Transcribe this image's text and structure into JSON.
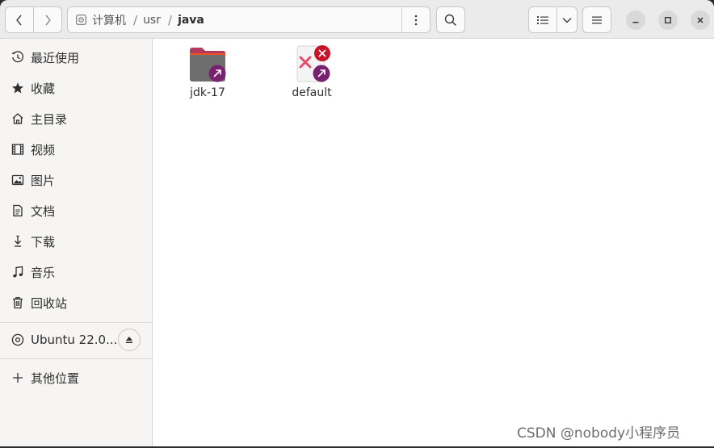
{
  "header": {
    "path": [
      "计算机",
      "usr",
      "java"
    ],
    "separator": "/"
  },
  "sidebar": {
    "items": [
      {
        "label": "最近使用",
        "icon": "clock-icon"
      },
      {
        "label": "收藏",
        "icon": "star-icon"
      },
      {
        "label": "主目录",
        "icon": "home-icon"
      },
      {
        "label": "视频",
        "icon": "video-icon"
      },
      {
        "label": "图片",
        "icon": "picture-icon"
      },
      {
        "label": "文档",
        "icon": "document-icon"
      },
      {
        "label": "下载",
        "icon": "download-icon"
      },
      {
        "label": "音乐",
        "icon": "music-icon"
      },
      {
        "label": "回收站",
        "icon": "trash-icon"
      }
    ],
    "drive": {
      "label": "Ubuntu 22.0...",
      "icon": "disc-icon"
    },
    "other": {
      "label": "其他位置",
      "icon": "plus-icon"
    }
  },
  "files": [
    {
      "name": "jdk-17",
      "type": "folder-link"
    },
    {
      "name": "default",
      "type": "broken-link"
    }
  ],
  "watermark": "CSDN @nobody小程序员",
  "colors": {
    "folder_top": "#e95420",
    "folder_body": "#6e6e6e",
    "link_badge": "#77216f",
    "broken_badge": "#c7162b"
  }
}
